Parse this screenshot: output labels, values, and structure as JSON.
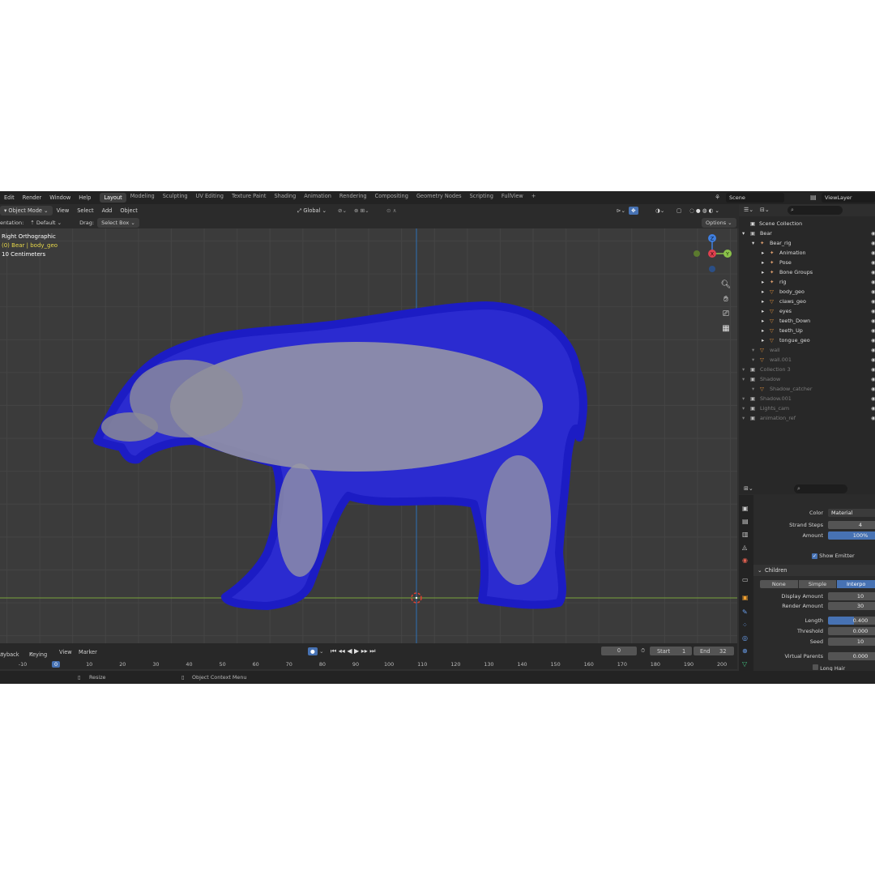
{
  "topbar": {
    "menus": [
      "Edit",
      "Render",
      "Window",
      "Help"
    ],
    "workspaces": [
      "Layout",
      "Modeling",
      "Sculpting",
      "UV Editing",
      "Texture Paint",
      "Shading",
      "Animation",
      "Rendering",
      "Compositing",
      "Geometry Nodes",
      "Scripting",
      "FullView"
    ],
    "active_workspace": "Layout",
    "add_tab": "+",
    "scene": "Scene",
    "view_layer": "ViewLayer"
  },
  "viewport_header": {
    "mode": "Object Mode",
    "menus": [
      "View",
      "Select",
      "Add",
      "Object"
    ],
    "transform_orientation": "Global",
    "options": "Options"
  },
  "tool_settings": {
    "orientation_label": "entation:",
    "orientation_value": "Default",
    "drag_label": "Drag:",
    "drag_value": "Select Box"
  },
  "viewport_overlay": {
    "view_name": "Right Orthographic",
    "object_info": "(0) Bear | body_geo",
    "scale": "10 Centimeters"
  },
  "navigation_gizmo": {
    "x": "X",
    "y": "Y",
    "z": "Z"
  },
  "outliner": {
    "root": "Scene Collection",
    "rows": [
      {
        "label": "Bear",
        "indent": 0,
        "dim": false,
        "icon": "collection-icon"
      },
      {
        "label": "Bear_rig",
        "indent": 1,
        "dim": false,
        "icon": "armature-icon"
      },
      {
        "label": "Animation",
        "indent": 2,
        "dim": false,
        "icon": "action-icon"
      },
      {
        "label": "Pose",
        "indent": 2,
        "dim": false,
        "icon": "pose-icon"
      },
      {
        "label": "Bone Groups",
        "indent": 2,
        "dim": false,
        "icon": "bone-groups-icon"
      },
      {
        "label": "rig",
        "indent": 2,
        "dim": false,
        "icon": "bone-icon"
      },
      {
        "label": "body_geo",
        "indent": 2,
        "dim": false,
        "icon": "mesh-icon"
      },
      {
        "label": "claws_geo",
        "indent": 2,
        "dim": false,
        "icon": "mesh-icon"
      },
      {
        "label": "eyes",
        "indent": 2,
        "dim": false,
        "icon": "mesh-icon"
      },
      {
        "label": "teeth_Down",
        "indent": 2,
        "dim": false,
        "icon": "mesh-icon"
      },
      {
        "label": "teeth_Up",
        "indent": 2,
        "dim": false,
        "icon": "mesh-icon"
      },
      {
        "label": "tongue_geo",
        "indent": 2,
        "dim": false,
        "icon": "mesh-icon"
      },
      {
        "label": "wall",
        "indent": 1,
        "dim": true,
        "icon": "mesh-icon"
      },
      {
        "label": "wall.001",
        "indent": 1,
        "dim": true,
        "icon": "mesh-icon"
      },
      {
        "label": "Collection 3",
        "indent": 0,
        "dim": true,
        "icon": "collection-icon"
      },
      {
        "label": "Shadow",
        "indent": 0,
        "dim": true,
        "icon": "collection-icon"
      },
      {
        "label": "Shadow_catcher",
        "indent": 1,
        "dim": true,
        "icon": "mesh-icon"
      },
      {
        "label": "Shadow.001",
        "indent": 0,
        "dim": true,
        "icon": "collection-icon"
      },
      {
        "label": "Lights_cam",
        "indent": 0,
        "dim": true,
        "icon": "collection-icon"
      },
      {
        "label": "animation_ref",
        "indent": 0,
        "dim": true,
        "icon": "collection-icon"
      }
    ]
  },
  "properties": {
    "color_label": "Color",
    "color_value": "Material",
    "strand_steps_label": "Strand Steps",
    "strand_steps_value": "4",
    "amount_label": "Amount",
    "amount_value": "100%",
    "show_emitter": "Show Emitter",
    "children_title": "Children",
    "children_modes": [
      "None",
      "Simple",
      "Interpo"
    ],
    "active_children_mode": "Interpo",
    "display_amount_label": "Display Amount",
    "display_amount_value": "10",
    "render_amount_label": "Render Amount",
    "render_amount_value": "30",
    "length_label": "Length",
    "length_value": "0.400",
    "length_fill": 0.4,
    "threshold_label": "Threshold",
    "threshold_value": "0.000",
    "seed_label": "Seed",
    "seed_value": "10",
    "virtual_parents_label": "Virtual Parents",
    "virtual_parents_value": "0.000",
    "long_hair": "Long Hair"
  },
  "timeline": {
    "menus": [
      "ayback",
      "Keying",
      "View",
      "Marker"
    ],
    "current_frame": "0",
    "start_label": "Start",
    "start_value": "1",
    "end_label": "End",
    "end_value": "32",
    "ticks": [
      "-10",
      "0",
      "10",
      "20",
      "30",
      "40",
      "50",
      "60",
      "70",
      "80",
      "90",
      "100",
      "110",
      "120",
      "130",
      "140",
      "150",
      "160",
      "170",
      "180",
      "190",
      "200"
    ]
  },
  "statusbar": {
    "resize": "Resize",
    "context_menu": "Object Context Menu"
  },
  "colors": {
    "accent": "#4772b3",
    "hair_blue": "#2a2ad6",
    "x_axis": "#e0404f",
    "y_axis": "#8bc34a",
    "z_axis": "#3f7fe0"
  }
}
